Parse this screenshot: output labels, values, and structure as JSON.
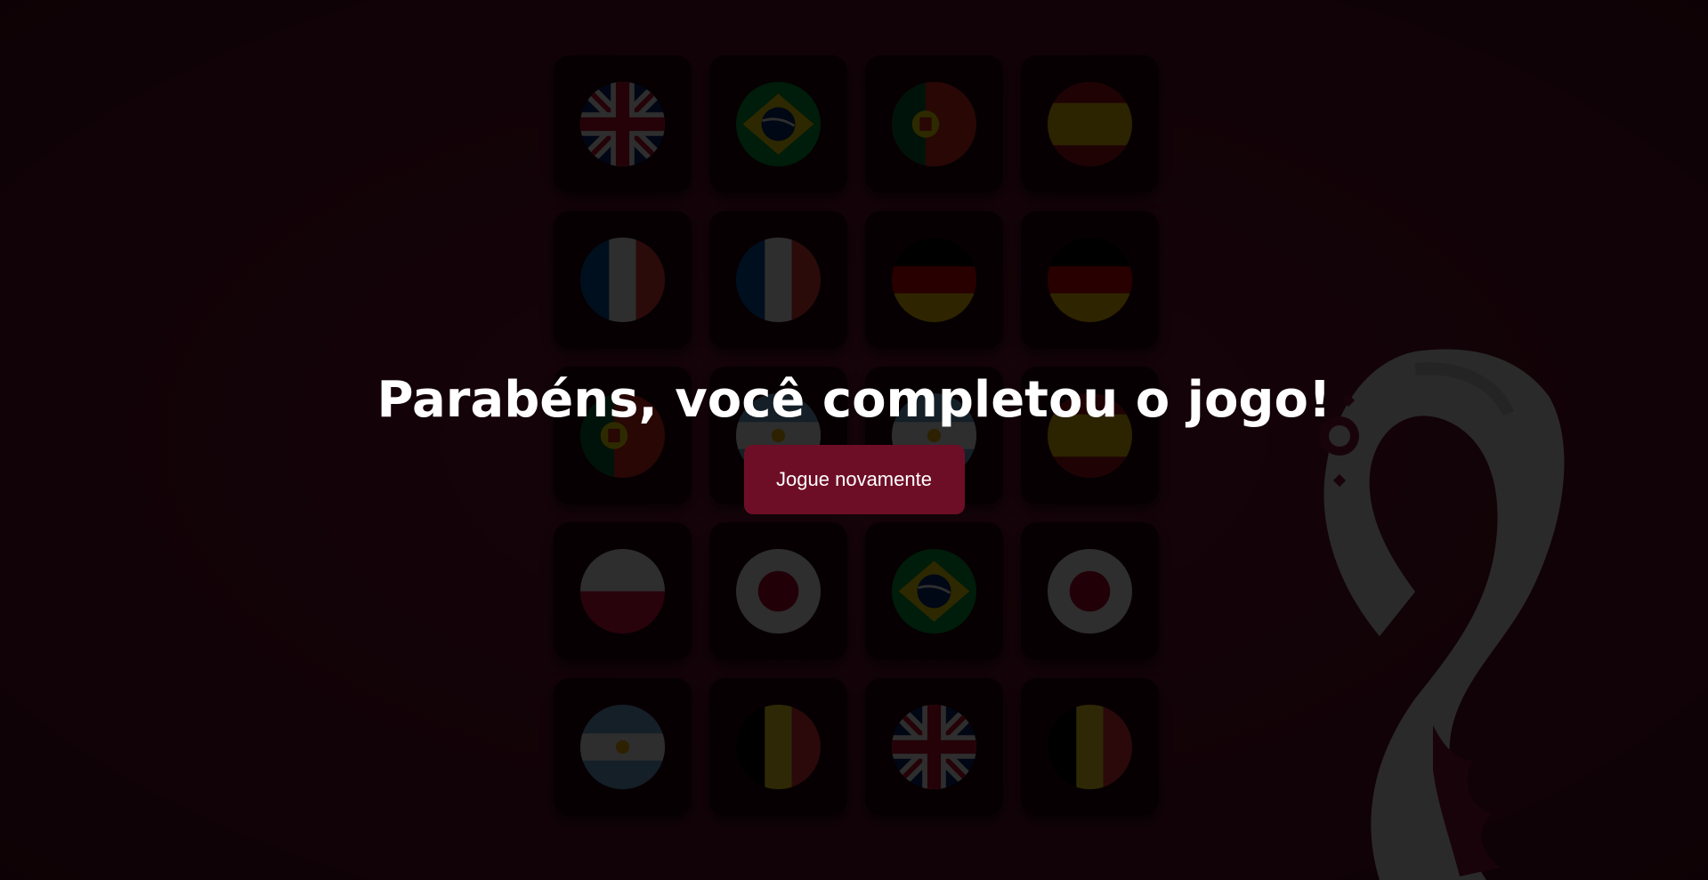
{
  "game": {
    "win_title": "Parabéns, você completou o jogo!",
    "replay_label": "Jogue novamente"
  },
  "board": {
    "columns": 4,
    "cards": [
      {
        "flag": "england"
      },
      {
        "flag": "brazil"
      },
      {
        "flag": "portugal"
      },
      {
        "flag": "spain"
      },
      {
        "flag": "france"
      },
      {
        "flag": "france"
      },
      {
        "flag": "germany"
      },
      {
        "flag": "germany"
      },
      {
        "flag": "portugal"
      },
      {
        "flag": "argentina"
      },
      {
        "flag": "argentina"
      },
      {
        "flag": "spain"
      },
      {
        "flag": "poland"
      },
      {
        "flag": "japan"
      },
      {
        "flag": "brazil"
      },
      {
        "flag": "japan"
      },
      {
        "flag": "argentina"
      },
      {
        "flag": "belgium"
      },
      {
        "flag": "england"
      },
      {
        "flag": "belgium"
      }
    ]
  },
  "colors": {
    "background": "#6b1230",
    "card": "#2a0410",
    "overlay": "rgba(0,0,0,0.82)",
    "button": "#6e0e26",
    "text": "#ffffff"
  }
}
